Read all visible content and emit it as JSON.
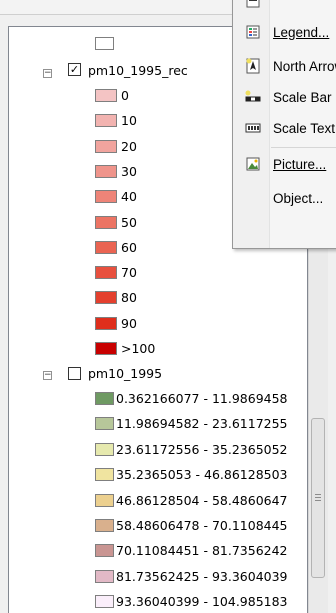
{
  "menu": {
    "items": [
      {
        "label": "",
        "icon": "text-icon"
      },
      {
        "label": "Legend...",
        "icon": "legend-icon"
      },
      {
        "label": "North Arrow",
        "icon": "north-arrow-icon"
      },
      {
        "label": "Scale Bar",
        "icon": "scale-bar-icon"
      },
      {
        "label": "Scale Text",
        "icon": "scale-text-icon"
      },
      {
        "label": "Picture...",
        "icon": "picture-icon"
      },
      {
        "label": "Object...",
        "icon": ""
      }
    ]
  },
  "toc": {
    "top_symbol": {
      "color": "#ffffff"
    },
    "layers": [
      {
        "name": "pm10_1995_rec",
        "checked": true,
        "expanded": true,
        "classes": [
          {
            "label": "0",
            "color": "#f4c4c4"
          },
          {
            "label": "10",
            "color": "#f2b3b0"
          },
          {
            "label": "20",
            "color": "#f1a49e"
          },
          {
            "label": "30",
            "color": "#ef948b"
          },
          {
            "label": "40",
            "color": "#ee8478"
          },
          {
            "label": "50",
            "color": "#ec7464"
          },
          {
            "label": "60",
            "color": "#ea6452"
          },
          {
            "label": "70",
            "color": "#e8503e"
          },
          {
            "label": "80",
            "color": "#e4402e"
          },
          {
            "label": "90",
            "color": "#df2e1c"
          },
          {
            "label": ">100",
            "color": "#c80000"
          }
        ]
      },
      {
        "name": "pm10_1995",
        "checked": false,
        "expanded": true,
        "classes": [
          {
            "label": "0.362166077 - 11.9869458",
            "color": "#6f9a63"
          },
          {
            "label": "11.98694582 - 23.6117255",
            "color": "#b7c79a"
          },
          {
            "label": "23.61172556 - 35.2365052",
            "color": "#e6e9ae"
          },
          {
            "label": "35.2365053 - 46.86128503",
            "color": "#f0e4a0"
          },
          {
            "label": "46.86128504 - 58.4860647",
            "color": "#ecd08f"
          },
          {
            "label": "58.48606478 - 70.1108445",
            "color": "#d9b08d"
          },
          {
            "label": "70.11084451 - 81.7356242",
            "color": "#c99592"
          },
          {
            "label": "81.73562425 - 93.3604039",
            "color": "#e2b9c6"
          },
          {
            "label": "93.36040399 - 104.985183",
            "color": "#faeefa"
          }
        ]
      }
    ]
  }
}
